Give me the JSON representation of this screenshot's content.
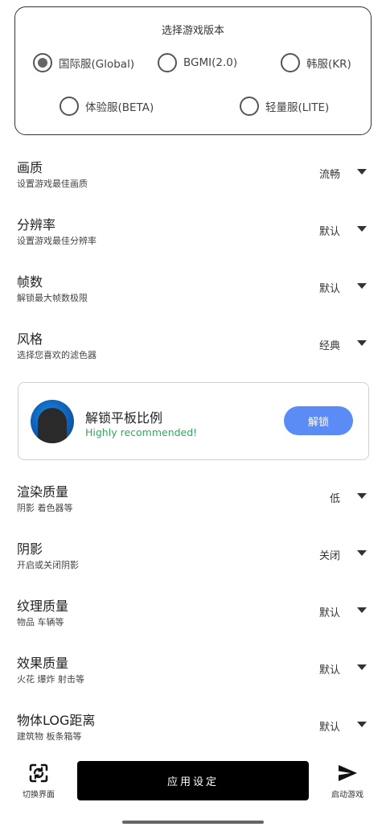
{
  "version_card": {
    "title": "选择游戏版本",
    "options": [
      {
        "label": "国际服(Global)",
        "selected": true
      },
      {
        "label": "BGMI(2.0)",
        "selected": false
      },
      {
        "label": "韩服(KR)",
        "selected": false
      },
      {
        "label": "体验服(BETA)",
        "selected": false
      },
      {
        "label": "轻量服(LITE)",
        "selected": false
      }
    ]
  },
  "settings": [
    {
      "title": "画质",
      "subtitle": "设置游戏最佳画质",
      "value": "流畅"
    },
    {
      "title": "分辨率",
      "subtitle": "设置游戏最佳分辨率",
      "value": "默认"
    },
    {
      "title": "帧数",
      "subtitle": "解锁最大帧数极限",
      "value": "默认"
    },
    {
      "title": "风格",
      "subtitle": "选择您喜欢的滤色器",
      "value": "经典"
    },
    {
      "title": "渲染质量",
      "subtitle": "阴影 着色器等",
      "value": "低"
    },
    {
      "title": "阴影",
      "subtitle": "开启或关闭阴影",
      "value": "关闭"
    },
    {
      "title": "纹理质量",
      "subtitle": "物品 车辆等",
      "value": "默认"
    },
    {
      "title": "效果质量",
      "subtitle": "火花 爆炸 射击等",
      "value": "默认"
    },
    {
      "title": "物体LOG距离",
      "subtitle": "建筑物 板条箱等",
      "value": "默认"
    }
  ],
  "unlock_card": {
    "title": "解锁平板比例",
    "subtitle": "Highly recommended!",
    "button": "解锁"
  },
  "bottom_bar": {
    "switch_label": "切换界面",
    "apply_label": "应用设定",
    "launch_label": "启动游戏"
  },
  "colors": {
    "accent_button": "#5b8cf5",
    "recommend_text": "#2eaa58",
    "primary_button": "#000000"
  }
}
